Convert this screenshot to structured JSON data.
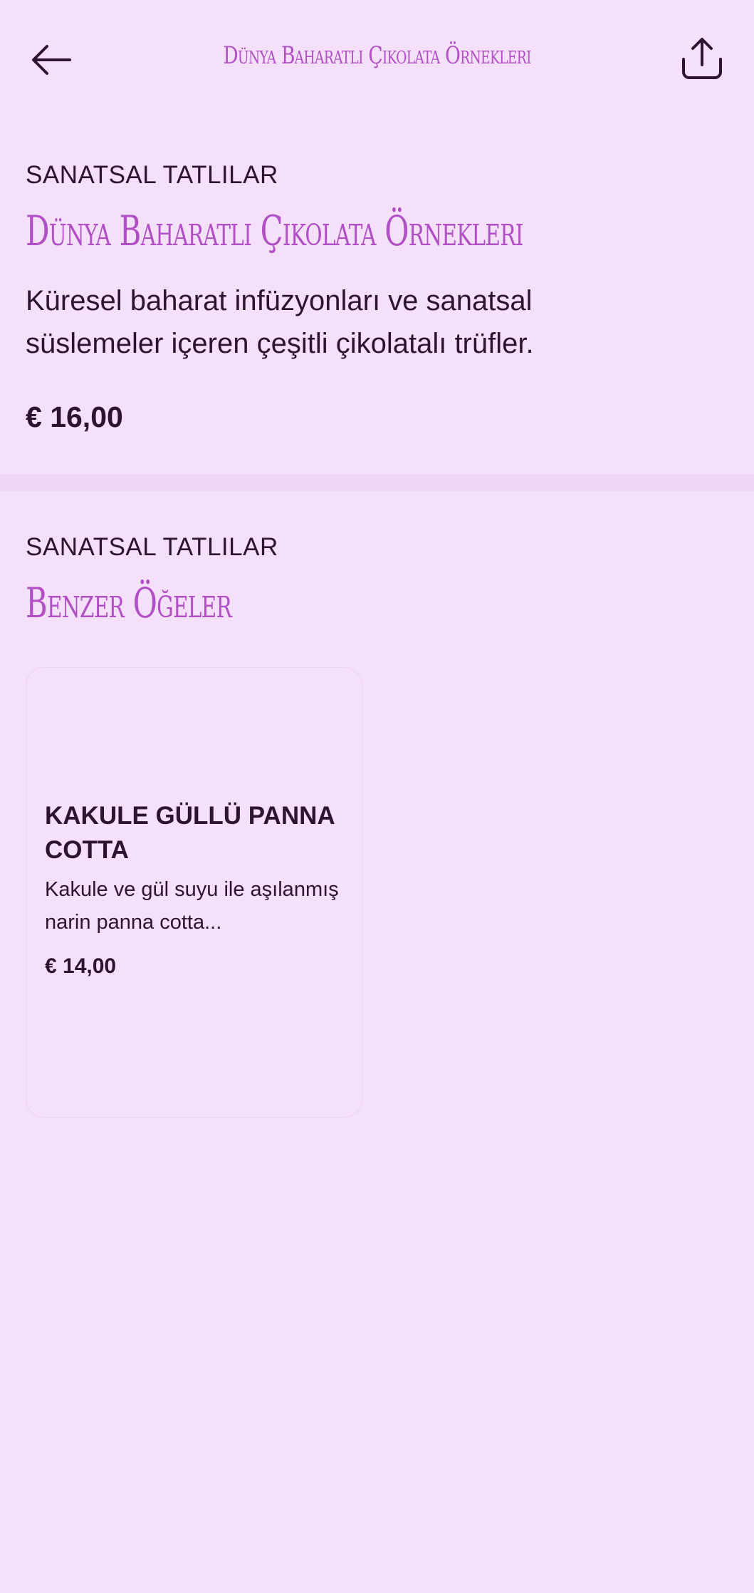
{
  "header": {
    "title": "Dünya Baharatlı Çikolata Örnekleri",
    "back_icon": "arrow-left-icon",
    "share_icon": "share-icon"
  },
  "product": {
    "category": "SANATSAL TATLILAR",
    "title": "Dünya Baharatlı Çikolata Örnekleri",
    "description": "Küresel baharat infüzyonları ve sanatsal süslemeler içeren çeşitli çikolatalı trüfler.",
    "price": "€ 16,00"
  },
  "similar": {
    "category": "SANATSAL TATLILAR",
    "title": "Benzer Öğeler",
    "items": [
      {
        "name": "KAKULE GÜLLÜ PANNA COTTA",
        "description": "Kakule ve gül suyu ile aşılanmış narin panna cotta...",
        "price": "€ 14,00"
      }
    ]
  },
  "colors": {
    "background": "#f4e0f8",
    "accent": "#b14fc5",
    "text": "#2e1433",
    "divider": "#f0d6f5"
  }
}
